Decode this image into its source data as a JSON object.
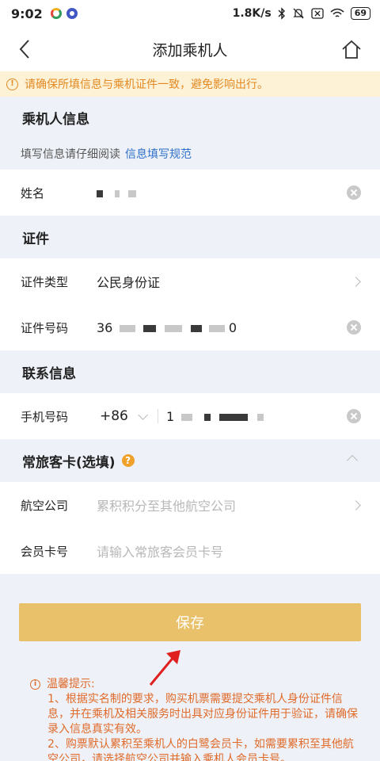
{
  "status_bar": {
    "time": "9:02",
    "speed": "1.8K/s",
    "battery": "69"
  },
  "nav": {
    "title": "添加乘机人"
  },
  "banner": {
    "text": "请确保所填信息与乘机证件一致，避免影响出行。"
  },
  "passenger": {
    "header": "乘机人信息",
    "note": "填写信息请仔细阅读",
    "note_link": "信息填写规范",
    "name_label": "姓名"
  },
  "certificate": {
    "header": "证件",
    "type_label": "证件类型",
    "type_value": "公民身份证",
    "number_label": "证件号码",
    "number_prefix": "36",
    "number_suffix": "0"
  },
  "contact": {
    "header": "联系信息",
    "phone_label": "手机号码",
    "country_code": "+86",
    "phone_prefix": "1"
  },
  "frequent_flyer": {
    "header": "常旅客卡(选填)",
    "help": "?",
    "airline_label": "航空公司",
    "airline_placeholder": "累积积分至其他航空公司",
    "card_label": "会员卡号",
    "card_placeholder": "请输入常旅客会员卡号"
  },
  "save_label": "保存",
  "tips": {
    "title": "温馨提示:",
    "line1": "1、根据实名制的要求，购买机票需要提交乘机人身份证件信息，并在乘机及相关服务时出具对应身份证件用于验证，请确保录入信息真实有效。",
    "line2": "2、购票默认累积至乘机人的白鹭会员卡，如需要累积至其他航空公司，请选择航空公司并输入乘机人会员卡号。"
  },
  "colors": {
    "accent": "#e8c16a",
    "warning": "#e38a23",
    "link": "#2f6fc8",
    "tip": "#e06a2a"
  }
}
